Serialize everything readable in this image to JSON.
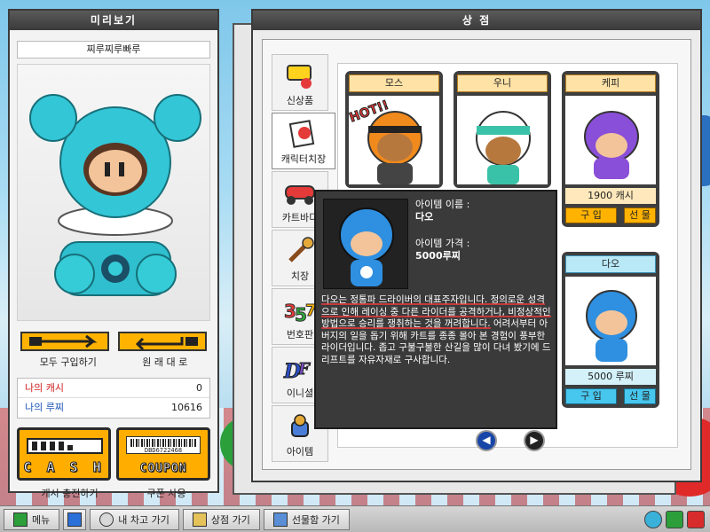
{
  "preview": {
    "title": "미리보기",
    "char_name": "찌루찌루빠루",
    "buy_all_label": "모두 구입하기",
    "revert_label": "원 래 대 로",
    "my_cash_label": "나의 캐시",
    "my_cash_value": "0",
    "my_lucci_label": "나의 루찌",
    "my_lucci_value": "10616",
    "cash_tile_text": "C A S H",
    "coupon_tile_text": "COUPON",
    "coupon_barcode": "DBD6722468",
    "cash_charge_label": "캐시 충전하기",
    "coupon_use_label": "쿠폰 사용"
  },
  "shop": {
    "title": "상 점",
    "categories": [
      {
        "label": "신상품",
        "icon": "new-icon"
      },
      {
        "label": "캐릭터치장",
        "icon": "character-icon"
      },
      {
        "label": "카트바디",
        "icon": "kart-icon"
      },
      {
        "label": "치장",
        "icon": "brush-icon"
      },
      {
        "label": "번호판",
        "icon": "number-plate-icon"
      },
      {
        "label": "이니셜",
        "icon": "initial-icon"
      },
      {
        "label": "아이템",
        "icon": "item-icon"
      }
    ],
    "cards": [
      {
        "name": "모스",
        "badge": "HOT!!"
      },
      {
        "name": "우니"
      },
      {
        "name": "케피",
        "price": "1900 캐시",
        "buy": "구 입",
        "gift": "선 물"
      },
      {
        "name": "다오",
        "price": "5000 루찌",
        "buy": "구 입",
        "gift": "선 물"
      }
    ]
  },
  "tooltip": {
    "name_label": "아이템 이름 :",
    "name_value": "다오",
    "price_label": "아이템 가격 :",
    "price_value": "5000루찌",
    "desc_1": "다오는 정통파 드라이버의 대표주자입니다. 정의로운 성격으로 인해 레이싱 중 다른 라이더를 공격하거나, 비정상적인 방법으로 승리를 쟁취하는 것을 꺼려합니다.",
    "desc_2": " 어려서부터 아버지의 일을 돕기 위해 카트를 종종 몰아 본 경험이 풍부한 라이더입니다. 좁고 구불구불한 산길을 많이 다녀 봤기에 드리프트를 자유자재로 구사합니다."
  },
  "taskbar": {
    "menu": "메뉴",
    "garage": "내 차고 가기",
    "shop": "상점 가기",
    "giftbox": "선물함 가기"
  },
  "colors": {
    "accent_orange": "#ffb300",
    "accent_blue": "#47c6ee",
    "title_bar": "#3a3a3a"
  }
}
